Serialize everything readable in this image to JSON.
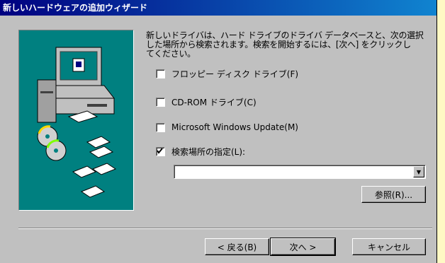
{
  "window": {
    "title": "新しいハードウェアの追加ウィザード"
  },
  "intro": {
    "lines": [
      "新しいドライバは、ハード ドライブのドライバ データベースと、次の選択",
      "した場所から検索されます。検索を開始するには、[次へ] をクリックし",
      "てください。"
    ]
  },
  "options": [
    {
      "label": "フロッピー ディスク ドライブ(F)",
      "checked": false
    },
    {
      "label": "CD-ROM ドライブ(C)",
      "checked": false
    },
    {
      "label": "Microsoft Windows Update(M)",
      "checked": false
    },
    {
      "label": "検索場所の指定(L):",
      "checked": true
    }
  ],
  "location": {
    "value": ""
  },
  "browse": {
    "label": "参照(R)..."
  },
  "footer": {
    "back_label": "< 戻る(B)",
    "next_label": "次へ >",
    "cancel_label": "キャンセル"
  },
  "colors": {
    "titlebar": "#000080",
    "illustration_bg": "#008080",
    "face": "#c0c0c0"
  }
}
